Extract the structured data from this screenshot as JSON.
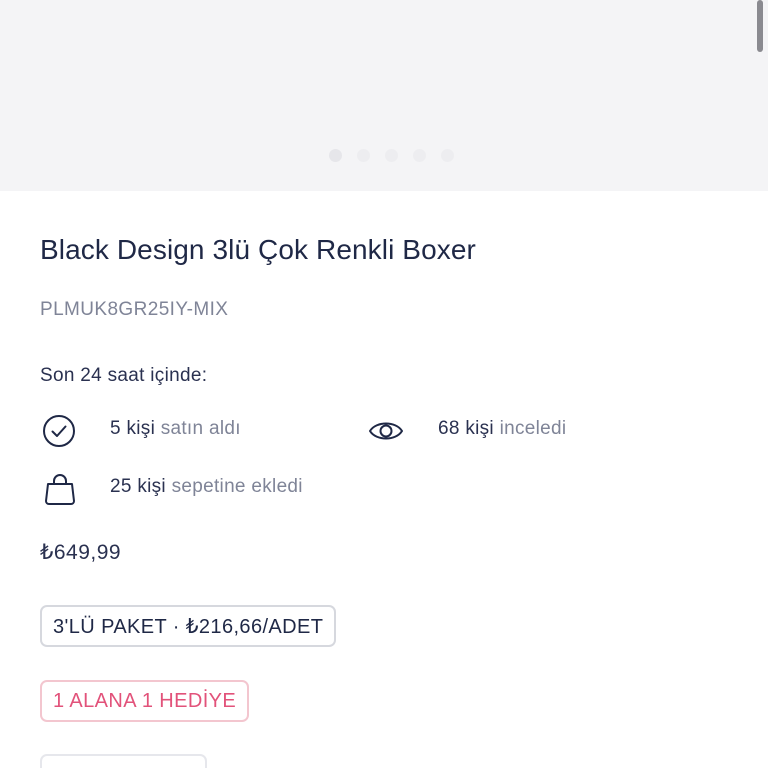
{
  "gallery": {
    "dots": [
      true,
      false,
      false,
      false,
      false
    ]
  },
  "product": {
    "title": "Black Design 3lü Çok Renkli Boxer",
    "sku": "PLMUK8GR25IY-MIX",
    "last24_label": "Son 24 saat içinde:",
    "stats": {
      "purchased": {
        "count": "5 kişi",
        "label": "satın aldı",
        "icon": "check-circle-icon"
      },
      "viewed": {
        "count": "68 kişi",
        "label": "inceledi",
        "icon": "eye-icon"
      },
      "carted": {
        "count": "25 kişi",
        "label": "sepetine ekledi",
        "icon": "shopping-bag-icon"
      }
    },
    "price": "₺649,99",
    "pack_tag": "3'LÜ PAKET · ₺216,66/ADET",
    "gift_tag": "1 ALANA 1 HEDİYE"
  },
  "colors": {
    "text_primary": "#1f2846",
    "text_secondary": "#7f8497",
    "gift_accent": "#e2527a"
  }
}
